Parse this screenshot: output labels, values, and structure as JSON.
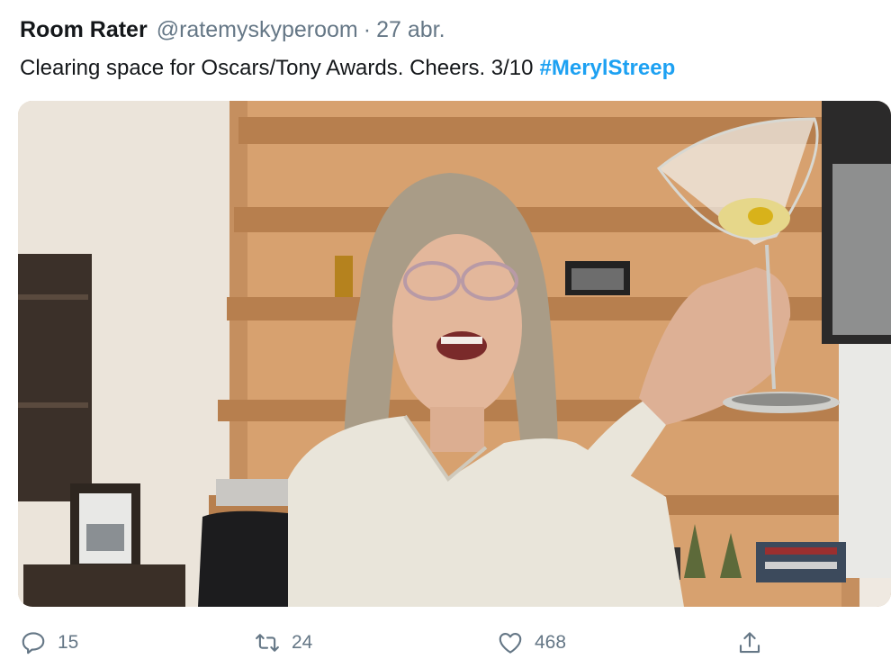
{
  "tweet": {
    "author": "Room Rater",
    "handle": "@ratemyskyperoom",
    "separator": "·",
    "date": "27 abr.",
    "text": "Clearing space for Oscars/Tony Awards. Cheers. 3/10",
    "hashtag": "#MerylStreep"
  },
  "media": {
    "icon": "photo"
  },
  "actions": {
    "reply": {
      "icon": "reply-icon",
      "count": "15"
    },
    "retweet": {
      "icon": "retweet-icon",
      "count": "24"
    },
    "like": {
      "icon": "heart-icon",
      "count": "468"
    },
    "share": {
      "icon": "share-icon"
    }
  },
  "colors": {
    "hashtag": "#1da1f2",
    "secondary_text": "#657786",
    "primary_text": "#14171a"
  }
}
